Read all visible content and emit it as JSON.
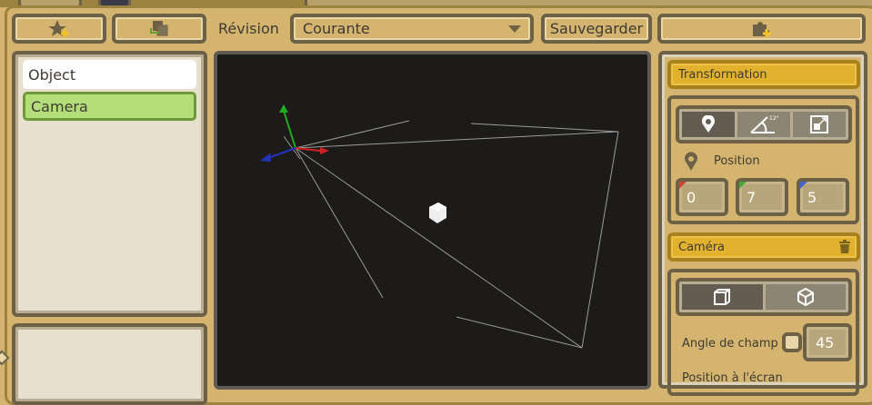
{
  "toolbar": {
    "revision_label": "Révision",
    "revision_value": "Courante",
    "save_label": "Sauvegarder"
  },
  "tree": {
    "items": [
      {
        "label": "Object"
      },
      {
        "label": "Camera"
      }
    ]
  },
  "inspector": {
    "transformation": {
      "title": "Transformation",
      "modes": [
        "position",
        "rotation",
        "scale"
      ],
      "rotation_hint": "12°",
      "position_label": "Position",
      "position": {
        "x": "0",
        "y": "7",
        "z": "5"
      }
    },
    "camera": {
      "title": "Caméra",
      "projections": [
        "orthographic",
        "perspective"
      ],
      "fov_label": "Angle de champ",
      "fov_value": "45",
      "screen_position_label": "Position à l'écran"
    }
  },
  "colors": {
    "accent": "#e2b22e",
    "selected": "#b4de7a",
    "x_axis": "#cc3333",
    "y_axis": "#22aa22",
    "z_axis": "#3355cc"
  }
}
